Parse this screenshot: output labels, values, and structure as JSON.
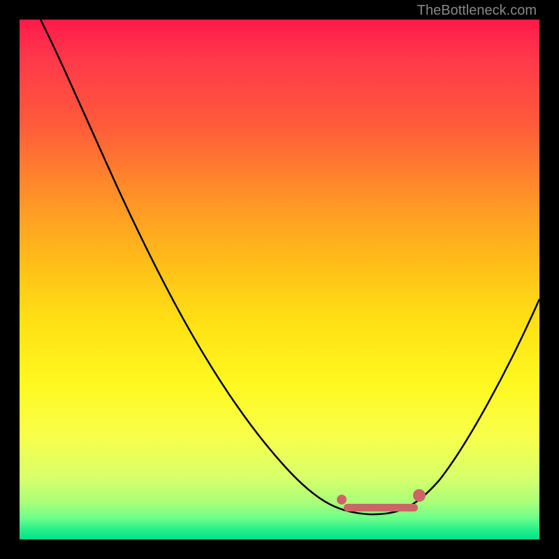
{
  "watermark": "TheBottleneck.com",
  "chart_data": {
    "type": "line",
    "title": "",
    "xlabel": "",
    "ylabel": "",
    "x_range": [
      0,
      100
    ],
    "y_range": [
      0,
      100
    ],
    "series": [
      {
        "name": "curve",
        "x": [
          4,
          10,
          20,
          30,
          40,
          50,
          58,
          62,
          66,
          70,
          74,
          78,
          82,
          88,
          94,
          100
        ],
        "y": [
          100,
          88,
          70,
          53,
          36,
          20,
          8,
          4,
          2,
          1,
          1,
          2,
          6,
          16,
          30,
          48
        ]
      }
    ],
    "highlight": {
      "name": "optimal-range",
      "color": "#cc6666",
      "x_start": 62,
      "x_end": 77,
      "y": 2
    },
    "background_gradient": {
      "top": "#ff1a4a",
      "bottom": "#00e28a",
      "meaning_top": "bad",
      "meaning_bottom": "good"
    }
  }
}
